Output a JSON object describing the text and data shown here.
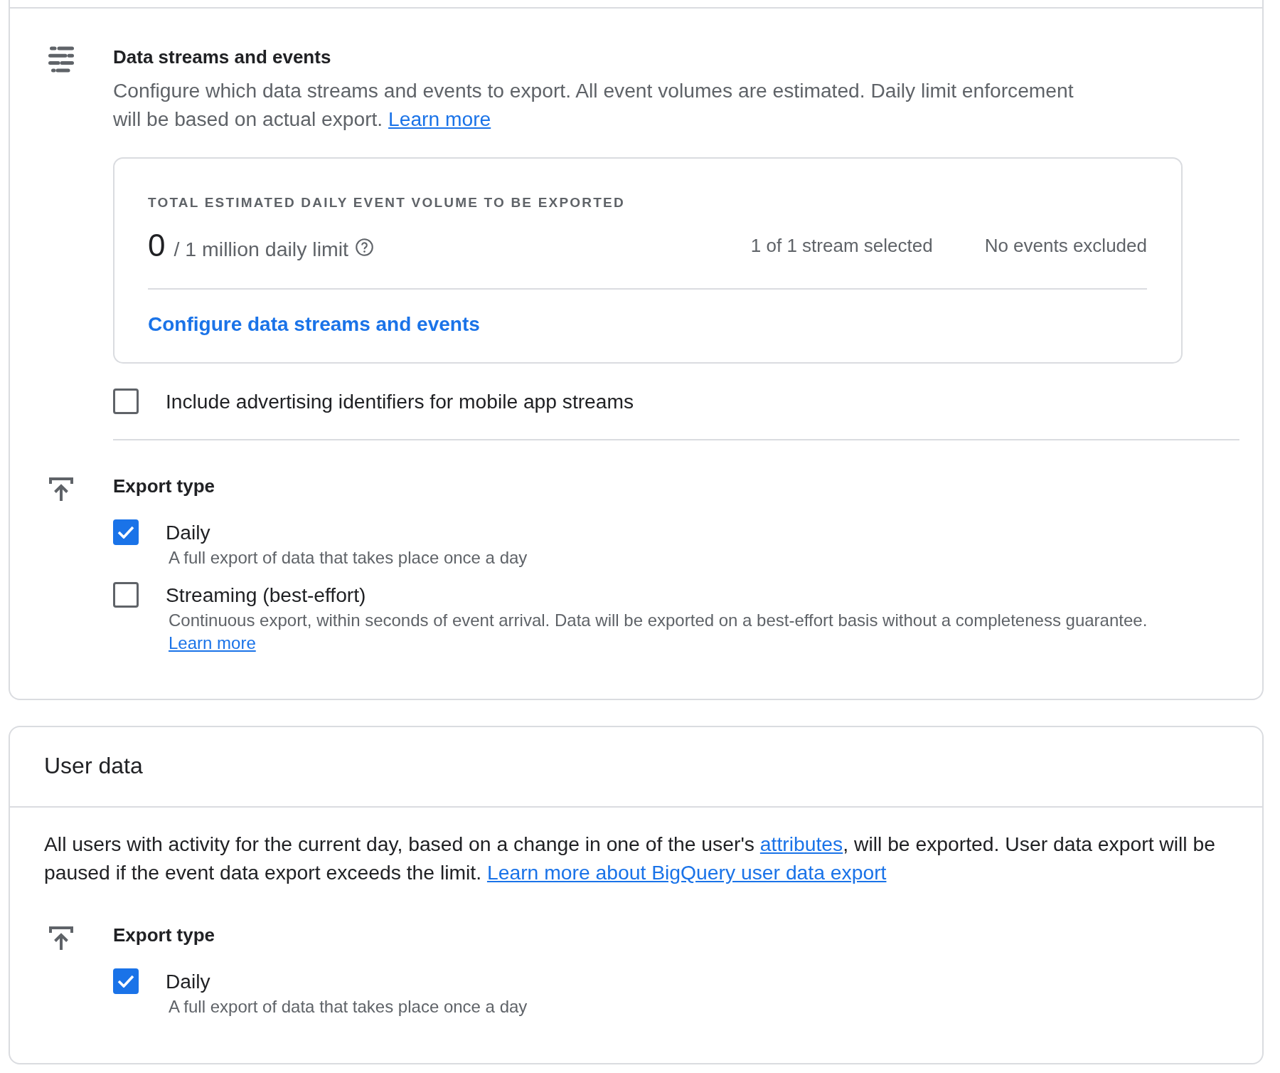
{
  "event_data_card": {
    "data_streams": {
      "title": "Data streams and events",
      "description": "Configure which data streams and events to export. All event volumes are estimated. Daily limit enforcement will be based on actual export.",
      "learn_more": "Learn more",
      "summary": {
        "heading": "TOTAL ESTIMATED DAILY EVENT VOLUME TO BE EXPORTED",
        "volume": "0",
        "limit": "/ 1 million daily limit",
        "streams": "1 of 1 stream selected",
        "events": "No events excluded",
        "configure_link": "Configure data streams and events"
      },
      "advertising_ids": {
        "label": "Include advertising identifiers for mobile app streams",
        "checked": false
      }
    },
    "export_type": {
      "title": "Export type",
      "options": [
        {
          "label": "Daily",
          "description": "A full export of data that takes place once a day",
          "checked": true
        },
        {
          "label": "Streaming (best-effort)",
          "description": "Continuous export, within seconds of event arrival. Data will be exported on a best-effort basis without a completeness guarantee.",
          "learn_more": "Learn more",
          "checked": false
        }
      ]
    }
  },
  "user_data_card": {
    "title": "User data",
    "description": {
      "before": "All users with activity for the current day, based on a change in one of the user's",
      "link": "attributes",
      "after": ", will be exported. User data export will be paused if the event data export exceeds the limit.",
      "learn_more": "Learn more about BigQuery user data export"
    },
    "export_type": {
      "title": "Export type",
      "options": [
        {
          "label": "Daily",
          "description": "A full export of data that takes place once a day",
          "checked": true
        }
      ]
    }
  }
}
